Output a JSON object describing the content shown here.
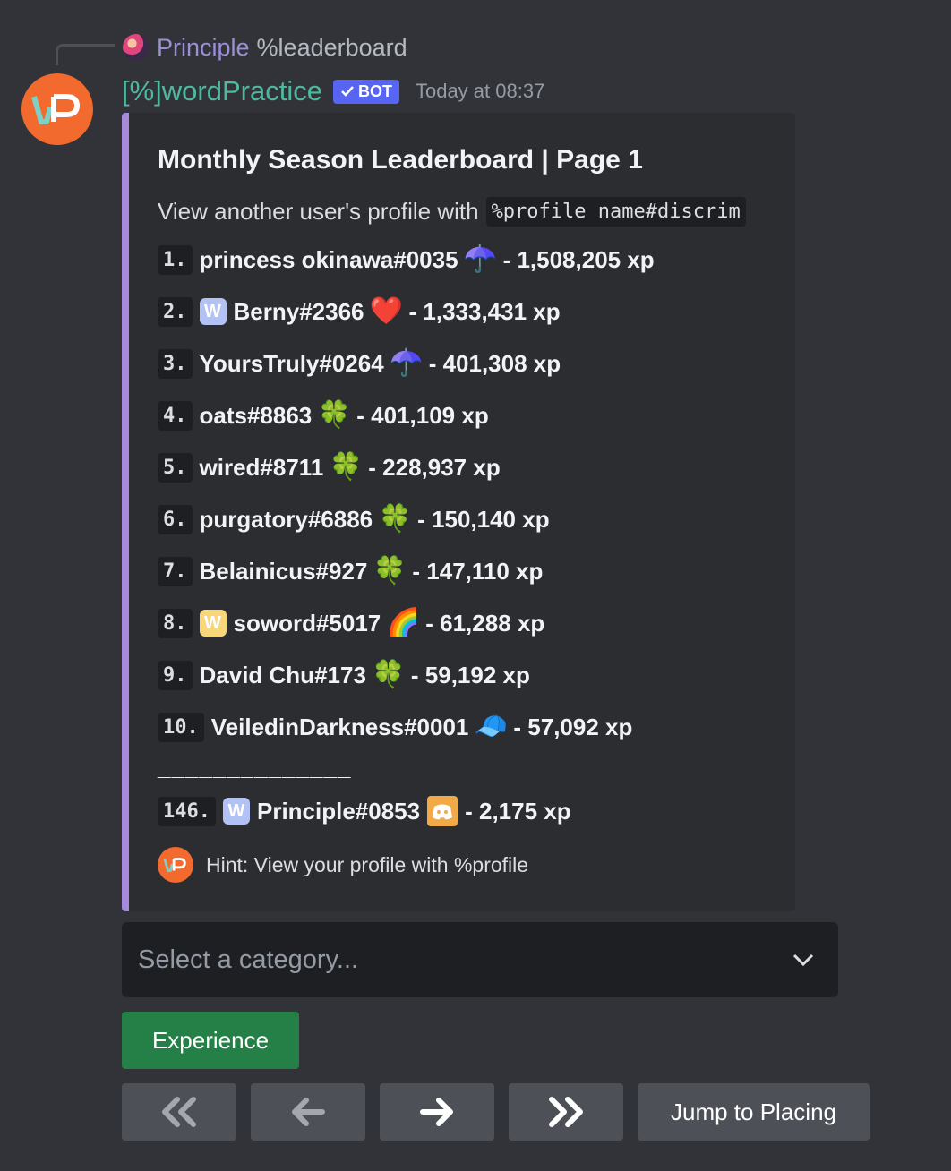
{
  "reply": {
    "author": "Principle",
    "command": "%leaderboard"
  },
  "message": {
    "author": "[%]wordPractice",
    "bot_tag": "BOT",
    "timestamp": "Today at 08:37",
    "avatar_text": "WP"
  },
  "embed": {
    "accent_color": "#a78bdb",
    "title": "Monthly Season Leaderboard | Page 1",
    "desc_prefix": "View another user's profile with",
    "desc_code": "%profile name#discrim",
    "entries": [
      {
        "rank": "1.",
        "badge": "",
        "name": "princess okinawa#0035",
        "emoji": "☂️",
        "xp": "- 1,508,205 xp"
      },
      {
        "rank": "2.",
        "badge": "W",
        "name": "Berny#2366",
        "emoji": "❤️",
        "xp": "- 1,333,431 xp"
      },
      {
        "rank": "3.",
        "badge": "",
        "name": "YoursTruly#0264",
        "emoji": "☂️",
        "xp": "- 401,308 xp"
      },
      {
        "rank": "4.",
        "badge": "",
        "name": "oats#8863",
        "emoji": "🍀",
        "xp": "- 401,109 xp"
      },
      {
        "rank": "5.",
        "badge": "",
        "name": "wired#8711",
        "emoji": "🍀",
        "xp": "- 228,937 xp"
      },
      {
        "rank": "6.",
        "badge": "",
        "name": "purgatory#6886",
        "emoji": "🍀",
        "xp": "- 150,140 xp"
      },
      {
        "rank": "7.",
        "badge": "",
        "name": "Belainicus#927",
        "emoji": "🍀",
        "xp": "- 147,110 xp"
      },
      {
        "rank": "8.",
        "badge": "W",
        "name": "soword#5017",
        "emoji": "🌈",
        "xp": "- 61,288 xp"
      },
      {
        "rank": "9.",
        "badge": "",
        "name": "David Chu#173",
        "emoji": "🍀",
        "xp": "- 59,192 xp"
      },
      {
        "rank": "10.",
        "badge": "",
        "name": "VeiledinDarkness#0001",
        "emoji": "🧢",
        "xp": "- 57,092 xp"
      }
    ],
    "separator": "______________",
    "own_entry": {
      "rank": "146.",
      "badge": "W",
      "name": "Principle#0853",
      "emoji": "🎮",
      "xp": "- 2,175 xp"
    },
    "footer": "Hint: View your profile with %profile"
  },
  "select": {
    "placeholder": "Select a category..."
  },
  "buttons": {
    "experience": "Experience",
    "first": "«",
    "prev": "←",
    "next": "→",
    "last": "»",
    "jump": "Jump to Placing"
  }
}
